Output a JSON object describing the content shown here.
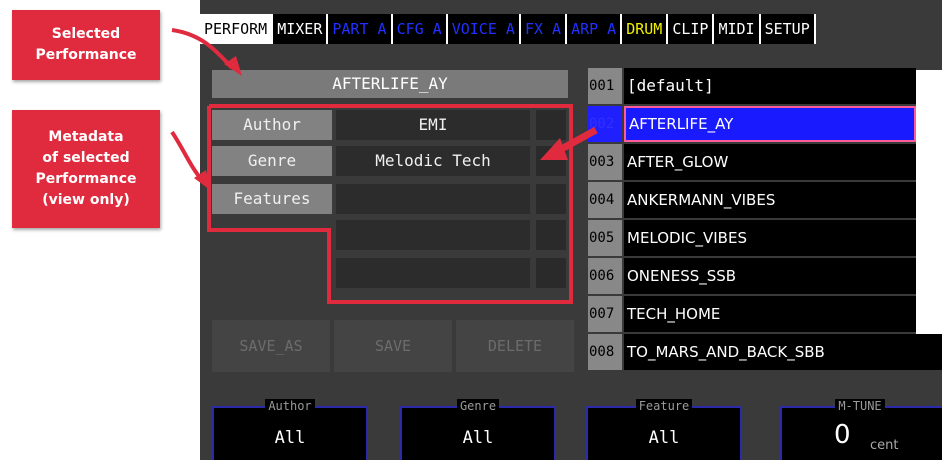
{
  "callouts": {
    "selected_performance": "Selected\nPerformance",
    "metadata": "Metadata\nof selected\nPerformance\n(view only)"
  },
  "tabs": [
    {
      "label": "PERFORM",
      "state": "active"
    },
    {
      "label": "MIXER",
      "state": "normal"
    },
    {
      "label": "PART A",
      "state": "blue"
    },
    {
      "label": "CFG A",
      "state": "blue"
    },
    {
      "label": "VOICE A",
      "state": "blue"
    },
    {
      "label": "FX A",
      "state": "blue"
    },
    {
      "label": "ARP A",
      "state": "blue"
    },
    {
      "label": "DRUM",
      "state": "yellow"
    },
    {
      "label": "CLIP",
      "state": "normal"
    },
    {
      "label": "MIDI",
      "state": "normal"
    },
    {
      "label": "SETUP",
      "state": "normal"
    }
  ],
  "selected_performance": "AFTERLIFE_AY",
  "metadata": {
    "author_label": "Author",
    "author_value": "EMI",
    "genre_label": "Genre",
    "genre_value": "Melodic Tech",
    "features_label": "Features",
    "features_values": [
      "",
      "",
      ""
    ]
  },
  "buttons": {
    "save_as": "SAVE_AS",
    "save": "SAVE",
    "delete": "DELETE"
  },
  "performances": [
    {
      "num": "001",
      "name": "[default]"
    },
    {
      "num": "002",
      "name": "AFTERLIFE_AY",
      "selected": true
    },
    {
      "num": "003",
      "name": "AFTER_GLOW"
    },
    {
      "num": "004",
      "name": "ANKERMANN_VIBES"
    },
    {
      "num": "005",
      "name": "MELODIC_VIBES"
    },
    {
      "num": "006",
      "name": "ONENESS_SSB"
    },
    {
      "num": "007",
      "name": "TECH_HOME"
    },
    {
      "num": "008",
      "name": "TO_MARS_AND_BACK_SBB"
    }
  ],
  "knobs": {
    "author": {
      "label": "Author",
      "value": "All"
    },
    "genre": {
      "label": "Genre",
      "value": "All"
    },
    "feature": {
      "label": "Feature",
      "value": "All"
    },
    "mtune": {
      "label": "M-TUNE",
      "value": "0",
      "unit": "cent"
    }
  },
  "colors": {
    "callout_red": "#e02a3e",
    "selection_blue": "#1a1aff",
    "tab_blue_text": "#2030ff",
    "tab_yellow_text": "#f0f000"
  }
}
